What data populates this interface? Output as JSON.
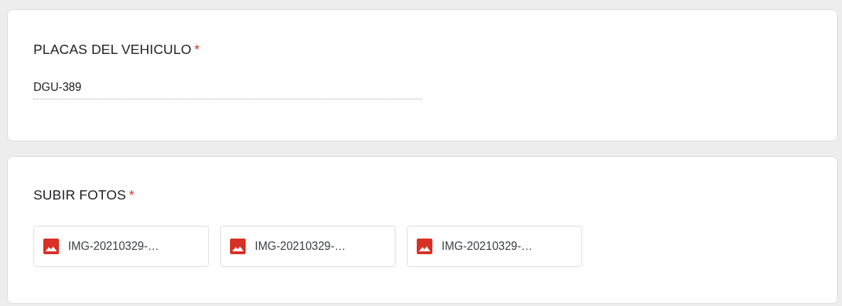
{
  "questions": [
    {
      "kind": "text",
      "title": "PLACAS DEL VEHICULO",
      "required_mark": "*",
      "value": "DGU-389"
    },
    {
      "kind": "files",
      "title": "SUBIR FOTOS",
      "required_mark": "*",
      "files": [
        "IMG-20210329-…",
        "IMG-20210329-…",
        "IMG-20210329-…"
      ]
    }
  ]
}
